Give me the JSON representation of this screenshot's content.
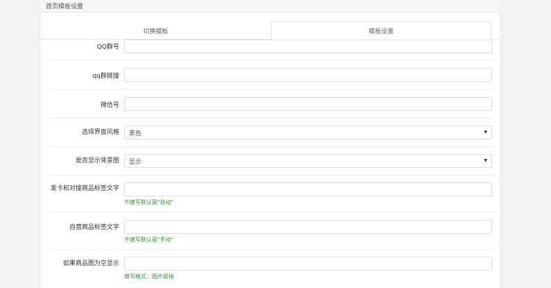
{
  "panel": {
    "title": "首页模板设置"
  },
  "tabs": [
    {
      "label": "切换模板"
    },
    {
      "label": "模板设置"
    }
  ],
  "fields": {
    "qq_group": {
      "label": "QQ群号",
      "value": ""
    },
    "qq_group_link": {
      "label": "qq群链接",
      "value": ""
    },
    "wechat": {
      "label": "微信号",
      "value": ""
    },
    "ui_style": {
      "label": "选择界面风格",
      "value": "黑色"
    },
    "show_bg": {
      "label": "是否显示背景图",
      "value": "显示"
    },
    "tag_auto": {
      "label": "发卡和对接商品标签文字",
      "value": "",
      "help": "不填写默认是\"自动\""
    },
    "tag_manual": {
      "label": "自营商品标签文字",
      "value": "",
      "help": "不填写默认是\"手动\""
    },
    "empty_image": {
      "label": "如果商品图为空显示",
      "value": "",
      "help": "填写格式：图片链接"
    }
  }
}
